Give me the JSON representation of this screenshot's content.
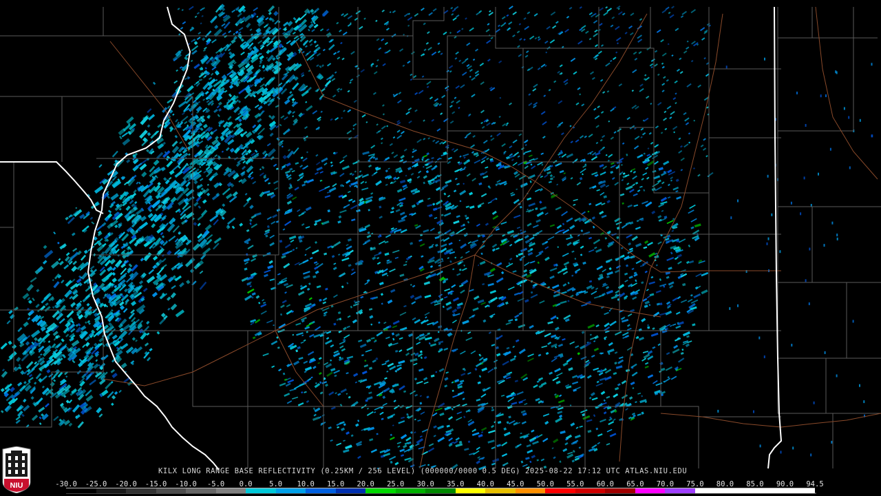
{
  "product_caption": "KILX LONG RANGE BASE REFLECTIVITY (0.25KM / 256 LEVEL) (000000/0000 0.5 DEG) 2025-08-22 17:12 UTC  ATLAS.NIU.EDU",
  "logo": {
    "text": "NIU",
    "icon": "niu-tower-logo-icon",
    "background_color": "#c8102e"
  },
  "radar": {
    "site": "KILX",
    "center_label": "radar-site"
  },
  "map_colors": {
    "background": "#000000",
    "county_lines": "#5a5a5a",
    "state_lines": "#ffffff",
    "highways": "#8a4a2a"
  },
  "color_scale": {
    "unit_labels": [
      "-30.0",
      "-25.0",
      "-20.0",
      "-15.0",
      "-10.0",
      "-5.0",
      "0.0",
      "5.0",
      "10.0",
      "15.0",
      "20.0",
      "25.0",
      "30.0",
      "35.0",
      "40.0",
      "45.0",
      "50.0",
      "55.0",
      "60.0",
      "65.0",
      "70.0",
      "75.0",
      "80.0",
      "85.0",
      "90.0",
      "94.5"
    ],
    "values": [
      -30,
      -25,
      -20,
      -15,
      -10,
      -5,
      0,
      5,
      10,
      15,
      20,
      25,
      30,
      35,
      40,
      45,
      50,
      55,
      60,
      65,
      70,
      75,
      80,
      85,
      90,
      94.5
    ],
    "colors": [
      "#000000",
      "#1a1a1a",
      "#333333",
      "#4d4d4d",
      "#666666",
      "#808080",
      "#00c8d8",
      "#00a0e8",
      "#0060e0",
      "#0030b0",
      "#00d800",
      "#00b000",
      "#008800",
      "#ffff00",
      "#e8c000",
      "#ff9000",
      "#ff0000",
      "#d00000",
      "#a00000",
      "#ff00ff",
      "#a040ff",
      "#ffffff",
      "#ffffff",
      "#ffffff",
      "#ffffff"
    ]
  }
}
